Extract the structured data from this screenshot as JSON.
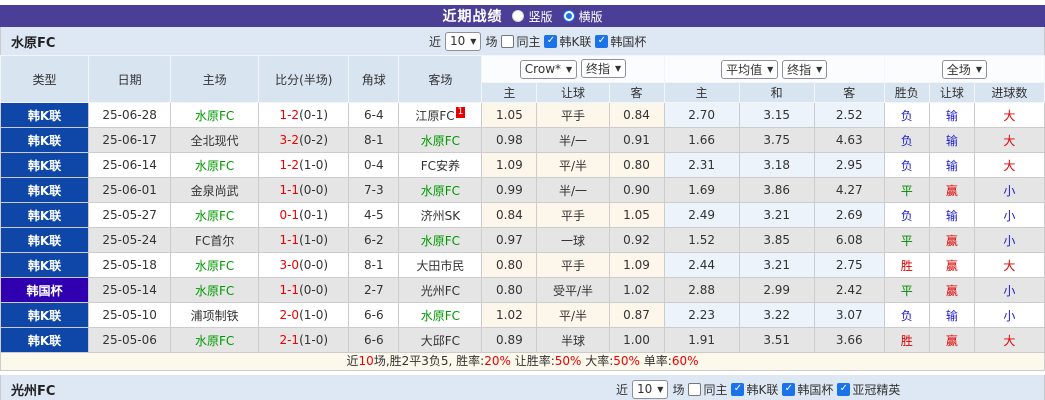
{
  "header": {
    "title": "近期战绩",
    "options": [
      {
        "label": "竖版",
        "selected": false
      },
      {
        "label": "横版",
        "selected": true
      }
    ]
  },
  "team_bar": {
    "team": "水原FC",
    "near_label": "近",
    "match_count": "10",
    "games_label": "场",
    "same_home_label": "同主",
    "same_home_checked": false,
    "filters": [
      {
        "label": "韩K联",
        "checked": true
      },
      {
        "label": "韩国杯",
        "checked": true
      }
    ]
  },
  "table": {
    "columns": [
      "类型",
      "日期",
      "主场",
      "比分(半场)",
      "角球",
      "客场"
    ],
    "odds_groups": {
      "asian_selects": [
        "Crow*",
        "终指"
      ],
      "euro_selects": [
        "平均值",
        "终指"
      ],
      "result_select": "全场"
    },
    "sub_columns": [
      "主",
      "让球",
      "客",
      "主",
      "和",
      "客",
      "胜负",
      "让球",
      "进球数"
    ],
    "rows": [
      {
        "league": "韩K联",
        "league_color": "blue",
        "date": "25-06-28",
        "home": {
          "name": "水原FC",
          "green": true
        },
        "score": "1-2",
        "half": "(0-1)",
        "corners": "6-4",
        "away": {
          "name": "江原FC",
          "green": false,
          "badge": "1"
        },
        "asian": [
          "1.05",
          "平手",
          "0.84"
        ],
        "euro": [
          "2.70",
          "3.15",
          "2.52"
        ],
        "results": [
          {
            "t": "负",
            "c": "blue"
          },
          {
            "t": "输",
            "c": "blue"
          },
          {
            "t": "大",
            "c": "red"
          }
        ]
      },
      {
        "league": "韩K联",
        "league_color": "blue",
        "date": "25-06-17",
        "home": {
          "name": "全北现代",
          "green": false
        },
        "score": "3-2",
        "half": "(0-2)",
        "corners": "8-1",
        "away": {
          "name": "水原FC",
          "green": true,
          "badge": ""
        },
        "asian": [
          "0.98",
          "半/一",
          "0.91"
        ],
        "euro": [
          "1.66",
          "3.75",
          "4.63"
        ],
        "results": [
          {
            "t": "负",
            "c": "blue"
          },
          {
            "t": "输",
            "c": "blue"
          },
          {
            "t": "大",
            "c": "red"
          }
        ]
      },
      {
        "league": "韩K联",
        "league_color": "blue",
        "date": "25-06-14",
        "home": {
          "name": "水原FC",
          "green": true
        },
        "score": "1-2",
        "half": "(1-0)",
        "corners": "0-4",
        "away": {
          "name": "FC安养",
          "green": false,
          "badge": ""
        },
        "asian": [
          "1.09",
          "平/半",
          "0.80"
        ],
        "euro": [
          "2.31",
          "3.18",
          "2.95"
        ],
        "results": [
          {
            "t": "负",
            "c": "blue"
          },
          {
            "t": "输",
            "c": "blue"
          },
          {
            "t": "大",
            "c": "red"
          }
        ]
      },
      {
        "league": "韩K联",
        "league_color": "blue",
        "date": "25-06-01",
        "home": {
          "name": "金泉尚武",
          "green": false
        },
        "score": "1-1",
        "half": "(0-0)",
        "corners": "7-3",
        "away": {
          "name": "水原FC",
          "green": true,
          "badge": ""
        },
        "asian": [
          "0.99",
          "半/一",
          "0.90"
        ],
        "euro": [
          "1.69",
          "3.86",
          "4.27"
        ],
        "results": [
          {
            "t": "平",
            "c": "green"
          },
          {
            "t": "赢",
            "c": "red"
          },
          {
            "t": "小",
            "c": "blue"
          }
        ]
      },
      {
        "league": "韩K联",
        "league_color": "blue",
        "date": "25-05-27",
        "home": {
          "name": "水原FC",
          "green": true
        },
        "score": "0-1",
        "half": "(0-1)",
        "corners": "4-5",
        "away": {
          "name": "济州SK",
          "green": false,
          "badge": ""
        },
        "asian": [
          "0.84",
          "平手",
          "1.05"
        ],
        "euro": [
          "2.49",
          "3.21",
          "2.69"
        ],
        "results": [
          {
            "t": "负",
            "c": "blue"
          },
          {
            "t": "输",
            "c": "blue"
          },
          {
            "t": "小",
            "c": "blue"
          }
        ]
      },
      {
        "league": "韩K联",
        "league_color": "blue",
        "date": "25-05-24",
        "home": {
          "name": "FC首尔",
          "green": false
        },
        "score": "1-1",
        "half": "(1-0)",
        "corners": "6-2",
        "away": {
          "name": "水原FC",
          "green": true,
          "badge": ""
        },
        "asian": [
          "0.97",
          "一球",
          "0.92"
        ],
        "euro": [
          "1.52",
          "3.85",
          "6.08"
        ],
        "results": [
          {
            "t": "平",
            "c": "green"
          },
          {
            "t": "赢",
            "c": "red"
          },
          {
            "t": "小",
            "c": "blue"
          }
        ]
      },
      {
        "league": "韩K联",
        "league_color": "blue",
        "date": "25-05-18",
        "home": {
          "name": "水原FC",
          "green": true
        },
        "score": "3-0",
        "half": "(0-0)",
        "corners": "8-1",
        "away": {
          "name": "大田市民",
          "green": false,
          "badge": ""
        },
        "asian": [
          "0.80",
          "平手",
          "1.09"
        ],
        "euro": [
          "2.44",
          "3.21",
          "2.75"
        ],
        "results": [
          {
            "t": "胜",
            "c": "red"
          },
          {
            "t": "赢",
            "c": "red"
          },
          {
            "t": "大",
            "c": "red"
          }
        ]
      },
      {
        "league": "韩国杯",
        "league_color": "purple",
        "date": "25-05-14",
        "home": {
          "name": "水原FC",
          "green": true
        },
        "score": "1-1",
        "half": "(0-0)",
        "corners": "2-7",
        "away": {
          "name": "光州FC",
          "green": false,
          "badge": ""
        },
        "asian": [
          "0.80",
          "受平/半",
          "1.02"
        ],
        "euro": [
          "2.88",
          "2.99",
          "2.42"
        ],
        "results": [
          {
            "t": "平",
            "c": "green"
          },
          {
            "t": "赢",
            "c": "red"
          },
          {
            "t": "小",
            "c": "blue"
          }
        ]
      },
      {
        "league": "韩K联",
        "league_color": "blue",
        "date": "25-05-10",
        "home": {
          "name": "浦项制铁",
          "green": false
        },
        "score": "2-0",
        "half": "(1-0)",
        "corners": "6-6",
        "away": {
          "name": "水原FC",
          "green": true,
          "badge": ""
        },
        "asian": [
          "1.02",
          "平/半",
          "0.87"
        ],
        "euro": [
          "2.23",
          "3.22",
          "3.07"
        ],
        "results": [
          {
            "t": "负",
            "c": "blue"
          },
          {
            "t": "输",
            "c": "blue"
          },
          {
            "t": "小",
            "c": "blue"
          }
        ]
      },
      {
        "league": "韩K联",
        "league_color": "blue",
        "date": "25-05-06",
        "home": {
          "name": "水原FC",
          "green": true
        },
        "score": "2-1",
        "half": "(1-0)",
        "corners": "6-6",
        "away": {
          "name": "大邱FC",
          "green": false,
          "badge": ""
        },
        "asian": [
          "0.89",
          "半球",
          "1.00"
        ],
        "euro": [
          "1.91",
          "3.51",
          "3.66"
        ],
        "results": [
          {
            "t": "胜",
            "c": "red"
          },
          {
            "t": "赢",
            "c": "red"
          },
          {
            "t": "大",
            "c": "red"
          }
        ]
      }
    ]
  },
  "summary": {
    "segments": [
      {
        "t": "近",
        "c": "black"
      },
      {
        "t": "10",
        "c": "red"
      },
      {
        "t": "场,胜2平3负5, 胜率:",
        "c": "black"
      },
      {
        "t": "20%",
        "c": "red"
      },
      {
        "t": " 让胜率:",
        "c": "black"
      },
      {
        "t": "50%",
        "c": "red"
      },
      {
        "t": " 大率:",
        "c": "black"
      },
      {
        "t": "50%",
        "c": "red"
      },
      {
        "t": " 单率:",
        "c": "black"
      },
      {
        "t": "60%",
        "c": "red"
      }
    ]
  },
  "next_section": {
    "team": "光州FC",
    "near_label": "近",
    "match_count": "10",
    "games_label": "场",
    "same_home_label": "同主",
    "same_home_checked": false,
    "filters": [
      {
        "label": "韩K联",
        "checked": true
      },
      {
        "label": "韩国杯",
        "checked": true
      },
      {
        "label": "亚冠精英",
        "checked": true
      }
    ]
  },
  "colors": {
    "accent_purple": "#4b3e97",
    "league_blue": "#0e47a8",
    "cup_purple": "#3000b0",
    "win_red": "#dd0000",
    "loss_blue": "#2222cc",
    "draw_green": "#008800",
    "team_green": "#009900",
    "checkbox_blue": "#1a73e8"
  }
}
